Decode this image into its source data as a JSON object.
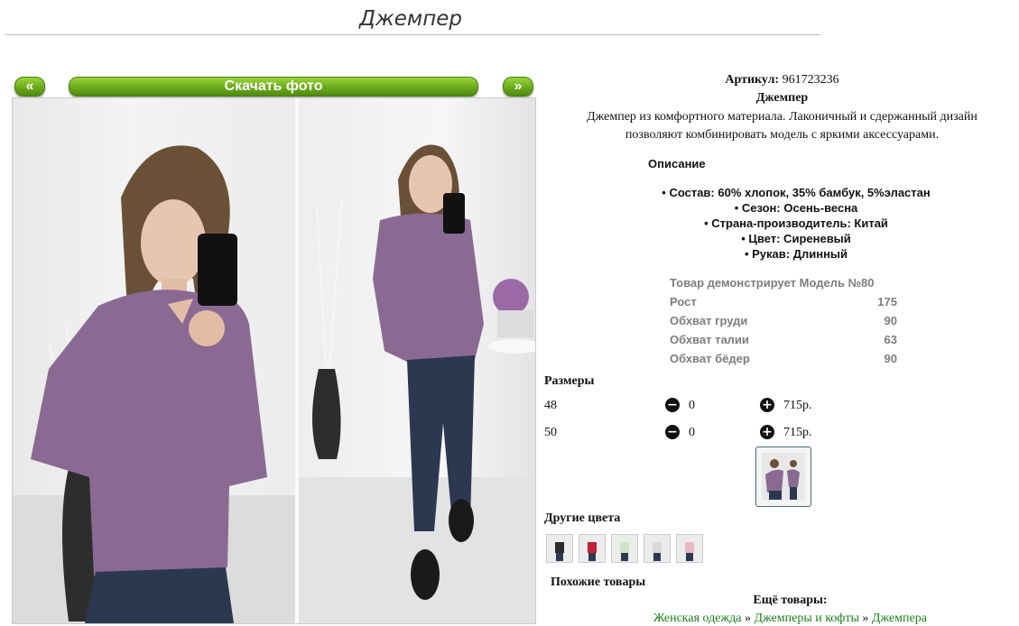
{
  "page": {
    "title": "Джемпер"
  },
  "gallery": {
    "prev_label": "«",
    "download_label": "Скачать фото",
    "next_label": "»"
  },
  "product": {
    "article_label": "Артикул:",
    "article_value": "961723236",
    "name": "Джемпер",
    "description_line1": "Джемпер из комфортного материала. Лаконичный и сдержанный дизайн",
    "description_line2": "позволяют комбинировать модель с яркими аксессуарами.",
    "description_heading": "Описание",
    "specs": [
      "Состав: 60% хлопок, 35% бамбук, 5%эластан",
      "Сезон: Осень-весна",
      "Страна-производитель: Китай",
      "Цвет: Сиреневый",
      "Рукав: Длинный"
    ]
  },
  "model": {
    "heading": "Товар демонстрирует Модель №80",
    "rows": [
      {
        "label": "Рост",
        "value": "175"
      },
      {
        "label": "Обхват груди",
        "value": "90"
      },
      {
        "label": "Обхват талии",
        "value": "63"
      },
      {
        "label": "Обхват бёдер",
        "value": "90"
      }
    ]
  },
  "sizes": {
    "heading": "Размеры",
    "rows": [
      {
        "size": "48",
        "qty": "0",
        "price": "715р."
      },
      {
        "size": "50",
        "qty": "0",
        "price": "715р."
      }
    ]
  },
  "other_colors": {
    "heading": "Другие цвета",
    "swatch_colors": [
      "#2b2b2b",
      "#c0203a",
      "#cfe3c8",
      "#d9d9d9",
      "#e8b9c4"
    ]
  },
  "similar": {
    "heading": "Похожие товары",
    "more_label": "Ещё товары:",
    "breadcrumb": [
      "Женская одежда",
      "Джемперы и кофты",
      "Джемпера"
    ],
    "separator": "»"
  },
  "colors": {
    "accent_green": "#6aab1c",
    "link_green": "#1a7f1a",
    "sweater": "#8a6a93",
    "jeans": "#2c3850"
  }
}
